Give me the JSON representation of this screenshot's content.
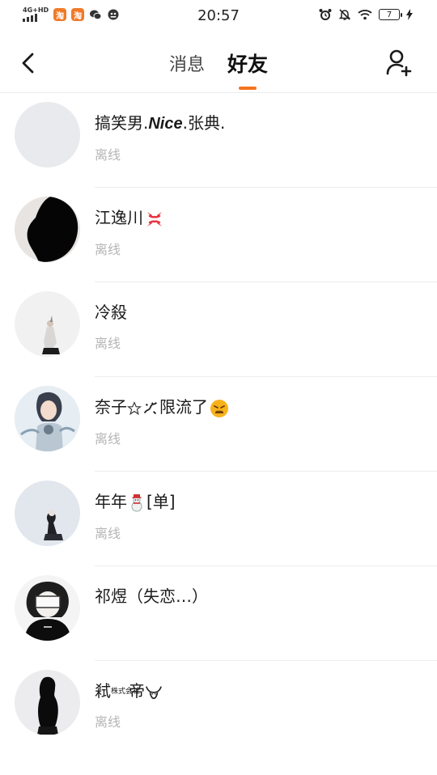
{
  "status_bar": {
    "network": "4G+HD",
    "time": "20:57",
    "battery": "7"
  },
  "nav": {
    "tabs": [
      {
        "label": "消息",
        "active": false
      },
      {
        "label": "好友",
        "active": true
      }
    ],
    "accent_color": "#f5731e"
  },
  "friends": [
    {
      "name": "搞笑男.",
      "name_italic": "Nice",
      "name_rest": ".张典.",
      "status": "离线"
    },
    {
      "name": "江逸川",
      "status": "离线"
    },
    {
      "name": "冷殺",
      "status": "离线"
    },
    {
      "name": "奈子",
      "name_rest": "限流了",
      "status": "离线"
    },
    {
      "name": "年年",
      "name_rest": "[单]",
      "status": "离线"
    },
    {
      "name": "祁煜（失恋…）",
      "status": ""
    },
    {
      "name": "弒",
      "name_small": "株式会社",
      "name_rest": "帝",
      "status": "离线"
    }
  ]
}
